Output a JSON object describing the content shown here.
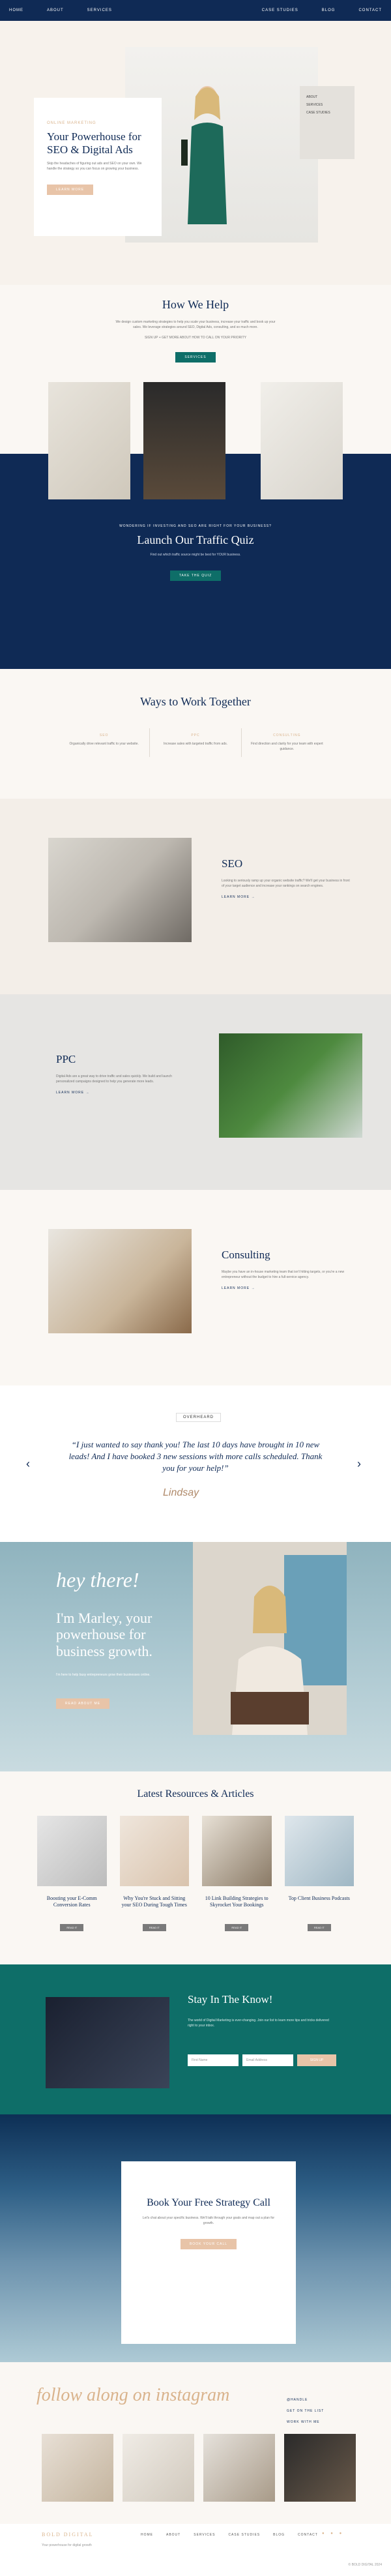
{
  "nav": {
    "left": [
      "HOME",
      "ABOUT",
      "SERVICES"
    ],
    "right": [
      "CASE STUDIES",
      "BLOG",
      "CONTACT"
    ]
  },
  "hero": {
    "eyebrow": "ONLINE MARKETING",
    "title": "Your Powerhouse for SEO & Digital Ads",
    "body": "Skip the headaches of figuring out ads and SEO on your own. We handle the strategy so you can focus on growing your business.",
    "button": "LEARN MORE",
    "side_menu": [
      "ABOUT",
      "SERVICES",
      "CASE STUDIES"
    ]
  },
  "help": {
    "title": "How We Help",
    "body": "We design custom marketing strategies to help you scale your business, increase your traffic and book up your sales. We leverage strategies around SEO, Digital Ads, consulting, and so much more.",
    "note": "SIGN UP + GET MORE ABOUT HOW TO CALL ON YOUR PRIORITY",
    "button": "SERVICES"
  },
  "quiz": {
    "eyebrow": "WONDERING IF INVESTING AND SEO ARE RIGHT FOR YOUR BUSINESS?",
    "title": "Launch Our Traffic Quiz",
    "body": "Find out which traffic source might be best for YOUR business.",
    "button": "TAKE THE QUIZ"
  },
  "ways": {
    "title": "Ways to Work Together",
    "cols": [
      {
        "t": "SEO",
        "d": "Organically drive relevant traffic to your website."
      },
      {
        "t": "PPC",
        "d": "Increase sales with targeted traffic from ads."
      },
      {
        "t": "CONSULTING",
        "d": "Find direction and clarity for your team with expert guidance."
      }
    ]
  },
  "seo": {
    "title": "SEO",
    "body": "Looking to seriously ramp up your organic website traffic? We'll get your business in front of your target audience and increase your rankings on search engines.",
    "link": "LEARN MORE →"
  },
  "ppc": {
    "title": "PPC",
    "body": "Digital Ads are a great way to drive traffic and sales quickly. We build and launch personalized campaigns designed to help you generate more leads.",
    "link": "LEARN MORE →"
  },
  "consulting": {
    "title": "Consulting",
    "body": "Maybe you have an in-house marketing team that isn't hitting targets, or you're a new entrepreneur without the budget to hire a full-service agency.",
    "link": "LEARN MORE →"
  },
  "testimonial": {
    "tag": "OVERHEARD",
    "quote": "“I just wanted to say thank you! The last 10 days have brought in 10 new leads! And I have booked 3 new sessions with more calls scheduled. Thank you for your help!”",
    "signature": "Lindsay"
  },
  "marley": {
    "script": "hey there!",
    "title": "I'm Marley, your powerhouse for business growth.",
    "body": "I'm here to help busy entrepreneurs grow their businesses online.",
    "button": "READ ABOUT ME"
  },
  "resources": {
    "title": "Latest Resources & Articles",
    "cards": [
      {
        "title": "Boosting your E-Comm Conversion Rates",
        "btn": "READ IT"
      },
      {
        "title": "Why You're Stuck and Sitting your SEO During Tough Times",
        "btn": "READ IT"
      },
      {
        "title": "10 Link Building Strategies to Skyrocket Your Bookings",
        "btn": "READ IT"
      },
      {
        "title": "Top Client Business Podcasts",
        "btn": "READ IT"
      }
    ]
  },
  "stay": {
    "title": "Stay In The Know!",
    "body": "The world of Digital Marketing is ever-changing. Join our list to learn more tips and tricks delivered right to your inbox.",
    "first_ph": "First Name",
    "email_ph": "Email Address",
    "button": "SIGN UP"
  },
  "book": {
    "title": "Book Your Free Strategy Call",
    "body": "Let's chat about your specific business. We'll talk through your goals and map out a plan for growth.",
    "button": "BOOK YOUR CALL"
  },
  "insta": {
    "script": "follow along on instagram",
    "handle": "@HANDLE",
    "links": [
      "@HANDLE",
      "GET ON THE LIST",
      "WORK WITH ME"
    ]
  },
  "footer": {
    "brand": "BOLD DIGITAL",
    "nav": [
      "HOME",
      "ABOUT",
      "SERVICES",
      "CASE STUDIES",
      "BLOG",
      "CONTACT"
    ],
    "addr": "Your powerhouse for digital growth",
    "copy": "© BOLD DIGITAL 2024"
  },
  "colors": {
    "navy": "#0f2a55",
    "teal": "#0e6e68",
    "peach": "#e8c4a8",
    "gold": "#d9b38c"
  }
}
